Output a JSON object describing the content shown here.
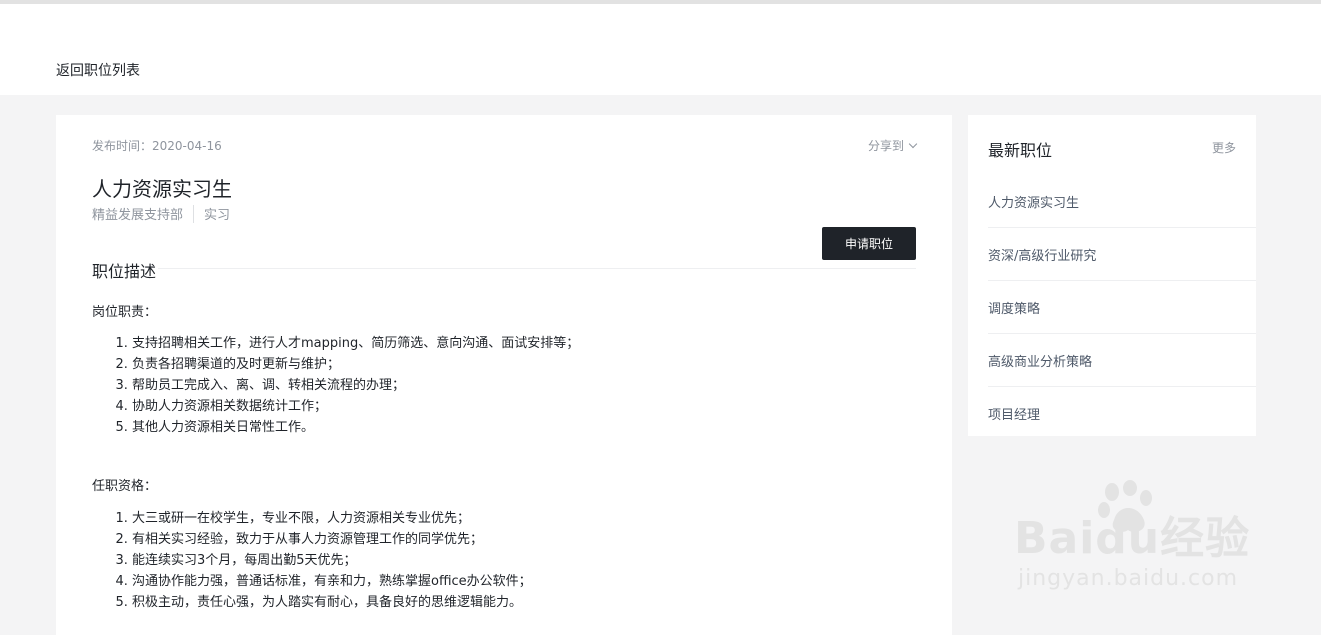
{
  "header": {
    "back_label": "返回职位列表"
  },
  "job": {
    "publish_date": "发布时间：2020-04-16",
    "share_label": "分享到",
    "title": "人力资源实习生",
    "department": "精益发展支持部",
    "type": "实习",
    "apply_label": "申请职位",
    "section_title": "职位描述",
    "duties_heading": "岗位职责：",
    "duties": [
      "支持招聘相关工作，进行人才mapping、简历筛选、意向沟通、面试安排等；",
      "负责各招聘渠道的及时更新与维护；",
      "帮助员工完成入、离、调、转相关流程的办理；",
      "协助人力资源相关数据统计工作；",
      "其他人力资源相关日常性工作。"
    ],
    "qualifications_heading": "任职资格：",
    "qualifications": [
      "大三或研一在校学生，专业不限，人力资源相关专业优先；",
      "有相关实习经验，致力于从事人力资源管理工作的同学优先；",
      "能连续实习3个月，每周出勤5天优先；",
      "沟通协作能力强，普通话标准，有亲和力，熟练掌握office办公软件；",
      "积极主动，责任心强，为人踏实有耐心，具备良好的思维逻辑能力。"
    ]
  },
  "sidebar": {
    "title": "最新职位",
    "more_label": "更多",
    "items": [
      "人力资源实习生",
      "资深/高级行业研究",
      "调度策略",
      "高级商业分析策略",
      "项目经理"
    ]
  },
  "watermark": {
    "brand": "Baidu经验",
    "url": "jingyan.baidu.com"
  },
  "icons": {
    "share_toggle": "chevron-down-icon",
    "watermark_logo": "baidu-paw-icon"
  }
}
